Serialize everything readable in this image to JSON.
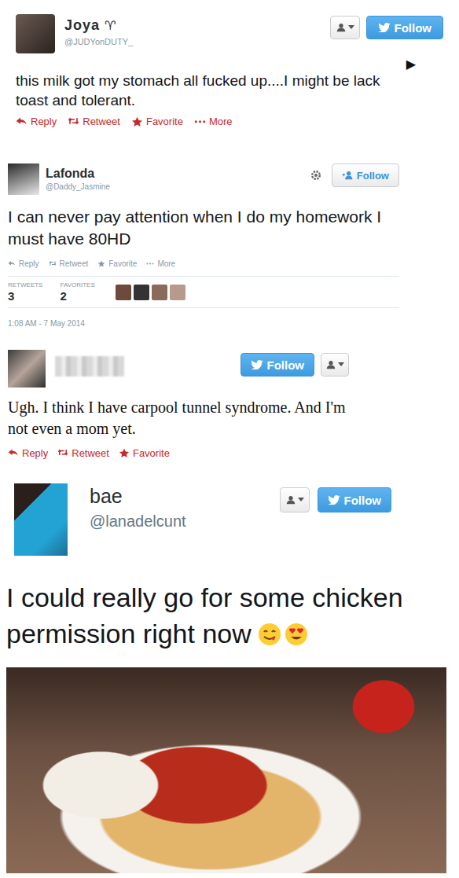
{
  "tweets": [
    {
      "kind": "classic",
      "name": "Joya",
      "zodiac": "♈",
      "handle": "@JUDYonDUTY_",
      "follow": "Follow",
      "arrow": "▶",
      "text": "this milk got my stomach all fucked up....I might be lack toast and tolerant.",
      "actions": [
        "Reply",
        "Retweet",
        "Favorite",
        "More"
      ]
    },
    {
      "kind": "stats",
      "name": "Lafonda",
      "handle": "@Daddy_Jasmine",
      "follow": "Follow",
      "text": "I can never pay attention when I do my homework I must have 80HD",
      "actions": [
        "Reply",
        "Retweet",
        "Favorite",
        "More"
      ],
      "stats": [
        {
          "label": "RETWEETS",
          "value": "3"
        },
        {
          "label": "FAVORITES",
          "value": "2"
        }
      ],
      "timestamp": "1:08 AM - 7 May 2014"
    },
    {
      "kind": "serif",
      "follow": "Follow",
      "text": "Ugh. I think I have carpool tunnel syndrome. And I'm not even a mom yet.",
      "actions": [
        "Reply",
        "Retweet",
        "Favorite"
      ]
    },
    {
      "kind": "photo",
      "name": "bae",
      "handle": "@lanadelcunt",
      "follow": "Follow",
      "text": "I could really go for some chicken permission right now"
    }
  ]
}
